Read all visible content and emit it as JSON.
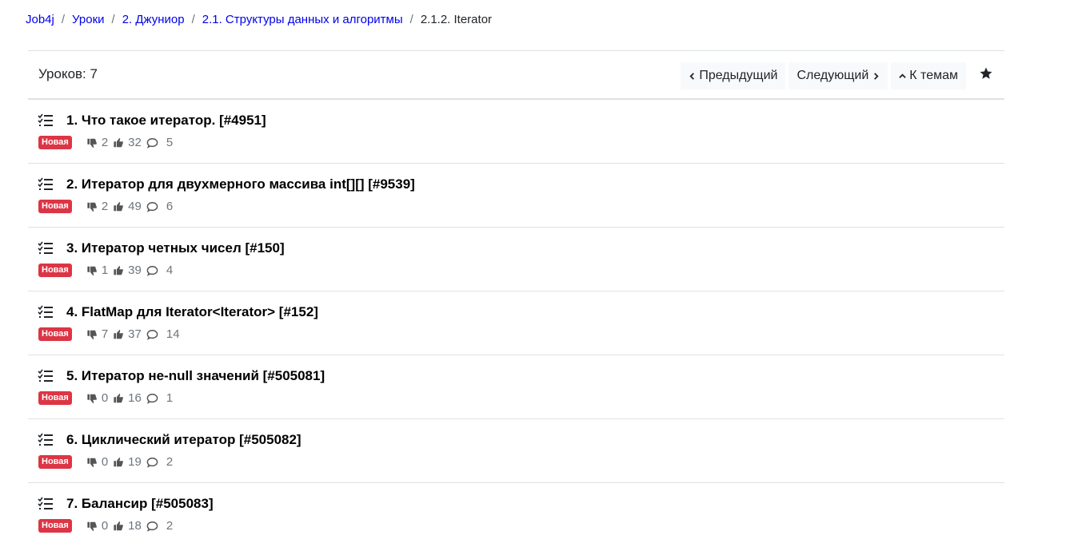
{
  "breadcrumb": {
    "items": [
      "Job4j",
      "Уроки",
      "2. Джуниор",
      "2.1. Структуры данных и алгоритмы"
    ],
    "current": "2.1.2. Iterator",
    "separator": "/"
  },
  "header": {
    "count_label": "Уроков: 7",
    "prev_label": "Предыдущий",
    "next_label": "Следующий",
    "topics_label": "К темам"
  },
  "lessons": [
    {
      "title": "1. Что такое итератор.   [#4951]",
      "badge": "Новая",
      "dislikes": "2",
      "likes": "32",
      "comments": "5"
    },
    {
      "title": "2. Итератор для двухмерного массива int[][]   [#9539]",
      "badge": "Новая",
      "dislikes": "2",
      "likes": "49",
      "comments": "6"
    },
    {
      "title": "3. Итератор четных чисел   [#150]",
      "badge": "Новая",
      "dislikes": "1",
      "likes": "39",
      "comments": "4"
    },
    {
      "title": "4. FlatMap для Iterator<Iterator>   [#152]",
      "badge": "Новая",
      "dislikes": "7",
      "likes": "37",
      "comments": "14"
    },
    {
      "title": "5. Итератор не-null значений   [#505081]",
      "badge": "Новая",
      "dislikes": "0",
      "likes": "16",
      "comments": "1"
    },
    {
      "title": "6. Циклический итератор   [#505082]",
      "badge": "Новая",
      "dislikes": "0",
      "likes": "19",
      "comments": "2"
    },
    {
      "title": "7. Балансир   [#505083]",
      "badge": "Новая",
      "dislikes": "0",
      "likes": "18",
      "comments": "2"
    }
  ],
  "colors": {
    "link": "#0000ee",
    "badge": "#dc3545",
    "button_bg": "#f8f9fa"
  },
  "icons": {
    "header": [
      "chevron-left-icon",
      "chevron-right-icon",
      "chevron-up-icon",
      "star-icon"
    ],
    "lesson": [
      "tasks-icon",
      "thumbs-down-icon",
      "thumbs-up-icon",
      "comments-icon"
    ]
  }
}
